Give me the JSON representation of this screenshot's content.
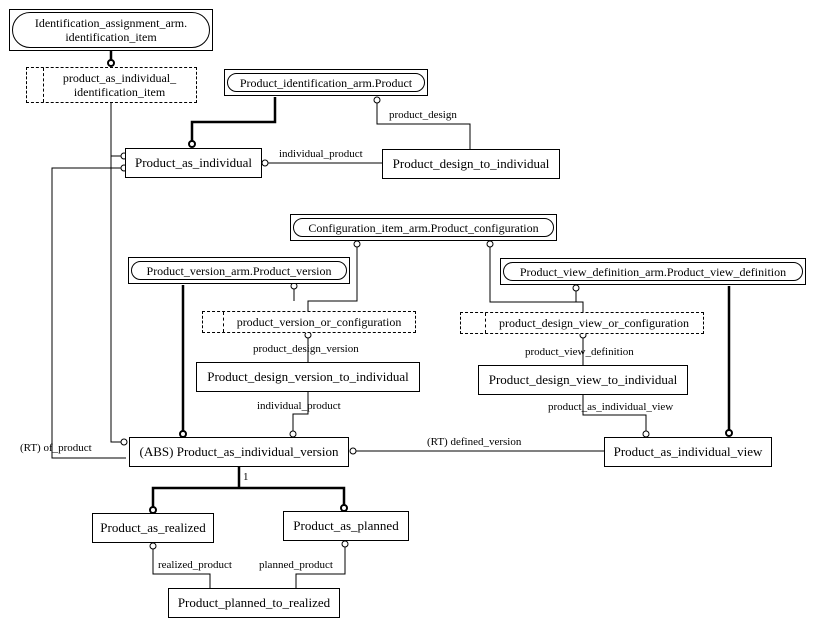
{
  "diagram": {
    "entities": {
      "identification_item": {
        "line1": "Identification_assignment_arm.",
        "line2": "identification_item",
        "kind": "referenced"
      },
      "pai_identification_item": {
        "line1": "product_as_individual_",
        "line2": "identification_item",
        "kind": "select"
      },
      "product": {
        "label": "Product_identification_arm.Product",
        "kind": "referenced"
      },
      "product_as_individual": {
        "label": "Product_as_individual",
        "kind": "entity"
      },
      "product_design_to_individual": {
        "label": "Product_design_to_individual",
        "kind": "entity"
      },
      "product_configuration": {
        "label": "Configuration_item_arm.Product_configuration",
        "kind": "referenced"
      },
      "product_version": {
        "label": "Product_version_arm.Product_version",
        "kind": "referenced"
      },
      "product_view_definition": {
        "label": "Product_view_definition_arm.Product_view_definition",
        "kind": "referenced"
      },
      "product_version_or_configuration": {
        "label": "product_version_or_configuration",
        "kind": "select"
      },
      "product_design_view_or_configuration": {
        "label": "product_design_view_or_configuration",
        "kind": "select"
      },
      "product_design_version_to_individual": {
        "label": "Product_design_version_to_individual",
        "kind": "entity"
      },
      "product_design_view_to_individual": {
        "label": "Product_design_view_to_individual",
        "kind": "entity"
      },
      "product_as_individual_version": {
        "label": "(ABS) Product_as_individual_version",
        "kind": "entity"
      },
      "product_as_individual_view": {
        "label": "Product_as_individual_view",
        "kind": "entity"
      },
      "product_as_realized": {
        "label": "Product_as_realized",
        "kind": "entity"
      },
      "product_as_planned": {
        "label": "Product_as_planned",
        "kind": "entity"
      },
      "product_planned_to_realized": {
        "label": "Product_planned_to_realized",
        "kind": "entity"
      }
    },
    "relationship_labels": {
      "product_design": "product_design",
      "individual_product_1": "individual_product",
      "product_design_version": "product_design_version",
      "individual_product_2": "individual_product",
      "product_view_definition": "product_view_definition",
      "product_as_individual_view": "product_as_individual_view",
      "of_product": "(RT) of_product",
      "defined_version": "(RT) defined_version",
      "one_of_cardinality": "1",
      "realized_product": "realized_product",
      "planned_product": "planned_product"
    }
  }
}
